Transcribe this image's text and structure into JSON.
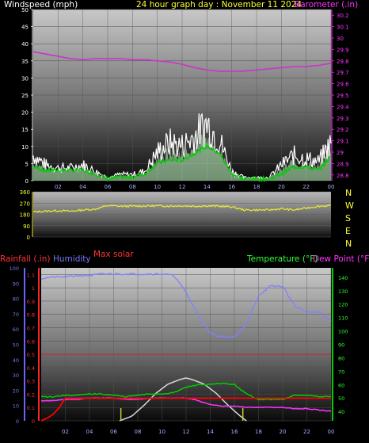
{
  "header": {
    "left_label": "Windspeed (mph)",
    "title": "24 hour graph day : November 11 2024",
    "right_label": "Barometer (.in)"
  },
  "mid_header": {
    "max_solar_label": "Max solar"
  },
  "bottom_header": {
    "rainfall_label": "Rainfall (.in)",
    "humidity_label": "Humidity",
    "temperature_label": "Temperature (°F)",
    "dewpoint_label": "Dew Point (°F)"
  },
  "colors": {
    "wind": "#ffffff",
    "wind_avg": "#00cc00",
    "gust_fill": "#c8ffc8",
    "barometer": "#cc33cc",
    "direction": "#e6e633",
    "rain": "#ff0000",
    "humidity": "#8080ff",
    "temperature": "#00cc00",
    "dewpoint": "#ff33ff",
    "solar": "#d8d8d8",
    "rain_label": "#ff3333",
    "humidity_label": "#7777ff",
    "temp_label": "#33ff33",
    "dew_label": "#ff33ff",
    "title_yellow": "#ffff33",
    "baro_label": "#ff33ff"
  },
  "chart_data": [
    {
      "id": "wind_baro",
      "type": "line",
      "x_ticks": [
        "02",
        "04",
        "06",
        "08",
        "10",
        "12",
        "14",
        "16",
        "18",
        "20",
        "22",
        "00"
      ],
      "y_left": {
        "label": "Windspeed (mph)",
        "ticks": [
          "0",
          "5",
          "10",
          "15",
          "20",
          "25",
          "30",
          "35",
          "40",
          "45",
          "50"
        ],
        "ylim": [
          0,
          50
        ]
      },
      "y_right": {
        "label": "Barometer (.in)",
        "ticks": [
          "28.8",
          "28.9",
          "29",
          "29.1",
          "29.2",
          "29.3",
          "29.4",
          "29.5",
          "29.6",
          "29.7",
          "29.8",
          "29.9",
          "30",
          "30.1",
          "30.2"
        ],
        "ylim": [
          28.75,
          30.25
        ]
      },
      "series": [
        {
          "name": "Windspeed (mph)",
          "axis": "left",
          "x": [
            0,
            1,
            2,
            3,
            4,
            5,
            6,
            7,
            8,
            9,
            10,
            11,
            12,
            13,
            14,
            15,
            16,
            17,
            18,
            19,
            20,
            21,
            22,
            23,
            24
          ],
          "values": [
            8,
            5,
            4,
            4,
            5,
            3,
            1,
            2,
            2,
            3,
            9,
            12,
            11,
            14,
            18,
            13,
            3,
            1,
            1,
            1,
            5,
            8,
            7,
            6,
            12
          ]
        },
        {
          "name": "Windspeed avg",
          "axis": "left",
          "x": [
            0,
            1,
            2,
            3,
            4,
            5,
            6,
            7,
            8,
            9,
            10,
            11,
            12,
            13,
            14,
            15,
            16,
            17,
            18,
            19,
            20,
            21,
            22,
            23,
            24
          ],
          "values": [
            4,
            3,
            3,
            3,
            3,
            2,
            0.5,
            1,
            1,
            2,
            5,
            6,
            6,
            8,
            10,
            8,
            2,
            0.5,
            0.5,
            0.5,
            2,
            4,
            4,
            3,
            7
          ]
        },
        {
          "name": "Barometer (.in)",
          "axis": "right",
          "x": [
            0,
            1,
            2,
            3,
            4,
            5,
            6,
            7,
            8,
            9,
            10,
            11,
            12,
            13,
            14,
            15,
            16,
            17,
            18,
            19,
            20,
            21,
            22,
            23,
            24
          ],
          "values": [
            29.88,
            29.86,
            29.84,
            29.82,
            29.81,
            29.82,
            29.82,
            29.82,
            29.81,
            29.81,
            29.8,
            29.79,
            29.77,
            29.74,
            29.72,
            29.71,
            29.71,
            29.71,
            29.72,
            29.73,
            29.74,
            29.75,
            29.75,
            29.76,
            29.78
          ]
        }
      ]
    },
    {
      "id": "direction",
      "type": "line",
      "x_ticks": [
        "02",
        "04",
        "06",
        "08",
        "10",
        "12",
        "14",
        "16",
        "18",
        "20",
        "22",
        "00"
      ],
      "y_left": {
        "ticks": [
          "0",
          "90",
          "180",
          "270",
          "360"
        ],
        "ylim": [
          0,
          360
        ]
      },
      "compass": [
        "N",
        "W",
        "S",
        "E",
        "N"
      ],
      "series": [
        {
          "name": "Wind direction",
          "x": [
            0,
            1,
            2,
            3,
            4,
            5,
            6,
            7,
            8,
            9,
            10,
            11,
            12,
            13,
            14,
            15,
            16,
            17,
            18,
            19,
            20,
            21,
            22,
            23,
            24
          ],
          "values": [
            200,
            205,
            210,
            205,
            215,
            222,
            250,
            245,
            245,
            247,
            248,
            246,
            248,
            245,
            248,
            245,
            240,
            215,
            215,
            215,
            225,
            215,
            230,
            245,
            250
          ]
        }
      ]
    },
    {
      "id": "temp_hum_rain",
      "type": "line",
      "x_ticks": [
        "02",
        "04",
        "06",
        "08",
        "10",
        "12",
        "14",
        "16",
        "18",
        "20",
        "22",
        "00"
      ],
      "y_humidity": {
        "ticks": [
          "0",
          "10",
          "20",
          "30",
          "40",
          "50",
          "60",
          "70",
          "80",
          "90",
          "100"
        ],
        "ylim": [
          0,
          100
        ]
      },
      "y_rain": {
        "ticks": [
          "0",
          "0.1",
          "0.2",
          "0.3",
          "0.4",
          "0.5",
          "0.6",
          "0.7",
          "0.8",
          "0.9",
          "1",
          "1.1"
        ],
        "ylim": [
          0,
          1.15
        ]
      },
      "y_temp": {
        "ticks": [
          "40",
          "50",
          "60",
          "70",
          "80",
          "90",
          "100",
          "110",
          "120",
          "130",
          "140"
        ],
        "ylim": [
          33,
          147
        ]
      },
      "series": [
        {
          "name": "Humidity",
          "axis": "humidity",
          "x": [
            0,
            1,
            2,
            3,
            4,
            5,
            6,
            7,
            8,
            9,
            10,
            11,
            12,
            13,
            14,
            15,
            16,
            17,
            18,
            19,
            20,
            21,
            22,
            23,
            24
          ],
          "values": [
            93,
            94,
            94,
            95,
            95,
            96,
            96,
            96,
            96,
            96,
            96,
            95,
            84,
            69,
            57,
            55,
            55,
            63,
            82,
            88,
            88,
            75,
            71,
            71,
            65
          ]
        },
        {
          "name": "Rainfall (.in)",
          "axis": "rain",
          "x": [
            0,
            0.5,
            1,
            1.5,
            2,
            4,
            8,
            12,
            16,
            20,
            24
          ],
          "values": [
            0,
            0.02,
            0.05,
            0.1,
            0.17,
            0.17,
            0.17,
            0.17,
            0.17,
            0.17,
            0.17
          ]
        },
        {
          "name": "Temperature (°F)",
          "axis": "temp",
          "x": [
            0,
            1,
            2,
            3,
            4,
            5,
            6,
            7,
            8,
            9,
            10,
            11,
            12,
            13,
            14,
            15,
            16,
            17,
            18,
            19,
            20,
            21,
            22,
            23,
            24
          ],
          "values": [
            51,
            51,
            52,
            52,
            53,
            53,
            52,
            51,
            52,
            53,
            53,
            54,
            58,
            60,
            60,
            61,
            60,
            53,
            49,
            49,
            49,
            52,
            52,
            51,
            51
          ]
        },
        {
          "name": "Dew Point (°F)",
          "axis": "temp",
          "x": [
            0,
            1,
            2,
            3,
            4,
            5,
            6,
            7,
            8,
            9,
            10,
            11,
            12,
            13,
            14,
            15,
            16,
            17,
            18,
            19,
            20,
            21,
            22,
            23,
            24
          ],
          "values": [
            48,
            48,
            49,
            49,
            50,
            50,
            50,
            49,
            49,
            50,
            50,
            50,
            50,
            48,
            45,
            44,
            44,
            43,
            43,
            43,
            43,
            42,
            42,
            41,
            40
          ]
        },
        {
          "name": "Max solar",
          "axis": "humidity",
          "x": [
            6.5,
            7.5,
            8.5,
            9.5,
            10.5,
            11.5,
            12,
            12.5,
            13.5,
            14.5,
            15.5,
            16.5,
            17
          ],
          "values": [
            0,
            3,
            10,
            18,
            24,
            27,
            28,
            27,
            24,
            18,
            10,
            3,
            0
          ]
        }
      ],
      "markers": {
        "sunrise": 6.6,
        "sunset": 16.7
      }
    }
  ]
}
